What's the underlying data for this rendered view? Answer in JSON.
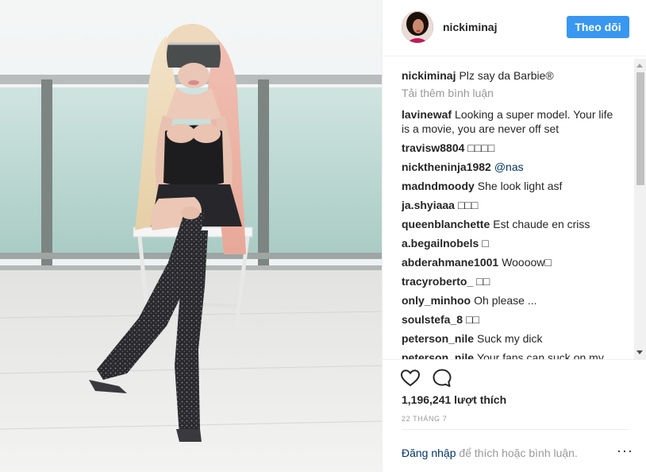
{
  "header": {
    "username": "nickiminaj",
    "follow_label": "Theo dõi"
  },
  "caption": {
    "user": "nickiminaj",
    "text": "Plz say da Barbie®"
  },
  "load_more_label": "Tải thêm bình luận",
  "comments": [
    {
      "user": "lavinewaf",
      "text": "Looking a super model. Your life is a movie, you are never off set"
    },
    {
      "user": "travisw8804",
      "text": "□□□□"
    },
    {
      "user": "nicktheninja1982",
      "text": "@nas"
    },
    {
      "user": "madndmoody",
      "text": "She look light asf"
    },
    {
      "user": "ja.shyiaaa",
      "text": "□□□"
    },
    {
      "user": "queenblanchette",
      "text": "Est chaude en criss"
    },
    {
      "user": "a.begailnobels",
      "text": "□"
    },
    {
      "user": "abderahmane1001",
      "text": "Woooow□"
    },
    {
      "user": "tracyroberto_",
      "text": "□□"
    },
    {
      "user": "only_minhoo",
      "text": "Oh please ..."
    },
    {
      "user": "soulstefa_8",
      "text": "□□"
    },
    {
      "user": "peterson_nile",
      "text": "Suck my dick"
    },
    {
      "user": "peterson_nile",
      "text": "Your fans can suck on my"
    }
  ],
  "likes_text": "1,196,241 lượt thích",
  "date_text": "22 tháng 7",
  "login": {
    "link_label": "Đăng nhập",
    "rest_text": "để thích hoặc bình luận."
  },
  "icons": {
    "like": "heart-icon",
    "comment": "comment-bubble-icon",
    "more": "more-options-icon"
  },
  "colors": {
    "follow_button": "#3897f0",
    "link": "#003569",
    "muted": "#999999"
  }
}
